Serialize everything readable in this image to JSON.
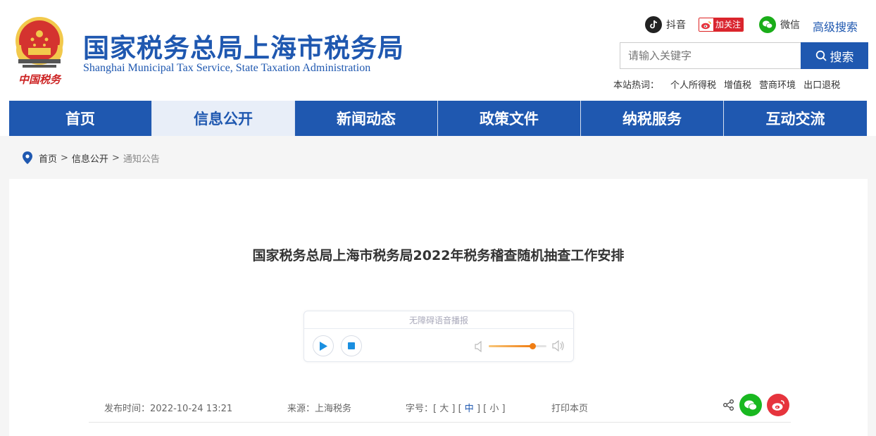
{
  "header": {
    "title": "国家税务总局上海市税务局",
    "subtitle": "Shanghai Municipal Tax Service, State Taxation Administration",
    "logo_text": "中国税务",
    "social": {
      "douyin_label": "抖音",
      "weibo_follow_label": "加关注",
      "wechat_label": "微信"
    },
    "advanced_search": "高级搜索",
    "search": {
      "placeholder": "请输入关键字",
      "button_label": "搜索"
    },
    "hot_words": {
      "label": "本站热词：",
      "items": [
        "个人所得税",
        "增值税",
        "营商环境",
        "出口退税"
      ]
    }
  },
  "nav": {
    "items": [
      {
        "label": "首页"
      },
      {
        "label": "信息公开"
      },
      {
        "label": "新闻动态"
      },
      {
        "label": "政策文件"
      },
      {
        "label": "纳税服务"
      },
      {
        "label": "互动交流"
      }
    ],
    "active": "信息公开"
  },
  "breadcrumb": {
    "items": [
      "首页",
      "信息公开",
      "通知公告"
    ],
    "separator": ">"
  },
  "article": {
    "title": "国家税务总局上海市税务局2022年税务稽查随机抽查工作安排",
    "audio": {
      "label": "无障碍语音播报",
      "volume": 0.75
    },
    "meta": {
      "date_label": "发布时间：",
      "date": "2022-10-24 13:21",
      "source_label": "来源：",
      "source": "上海税务",
      "font_label": "字号：",
      "font_sizes": [
        "大",
        "中",
        "小"
      ],
      "font_active": "中",
      "print": "打印本页"
    }
  },
  "colors": {
    "brand_blue": "#1f58b0",
    "nav_active_bg": "#e8eef8",
    "wechat_green": "#19b820",
    "weibo_red": "#e6343d",
    "volume_orange": "#f07d12"
  }
}
